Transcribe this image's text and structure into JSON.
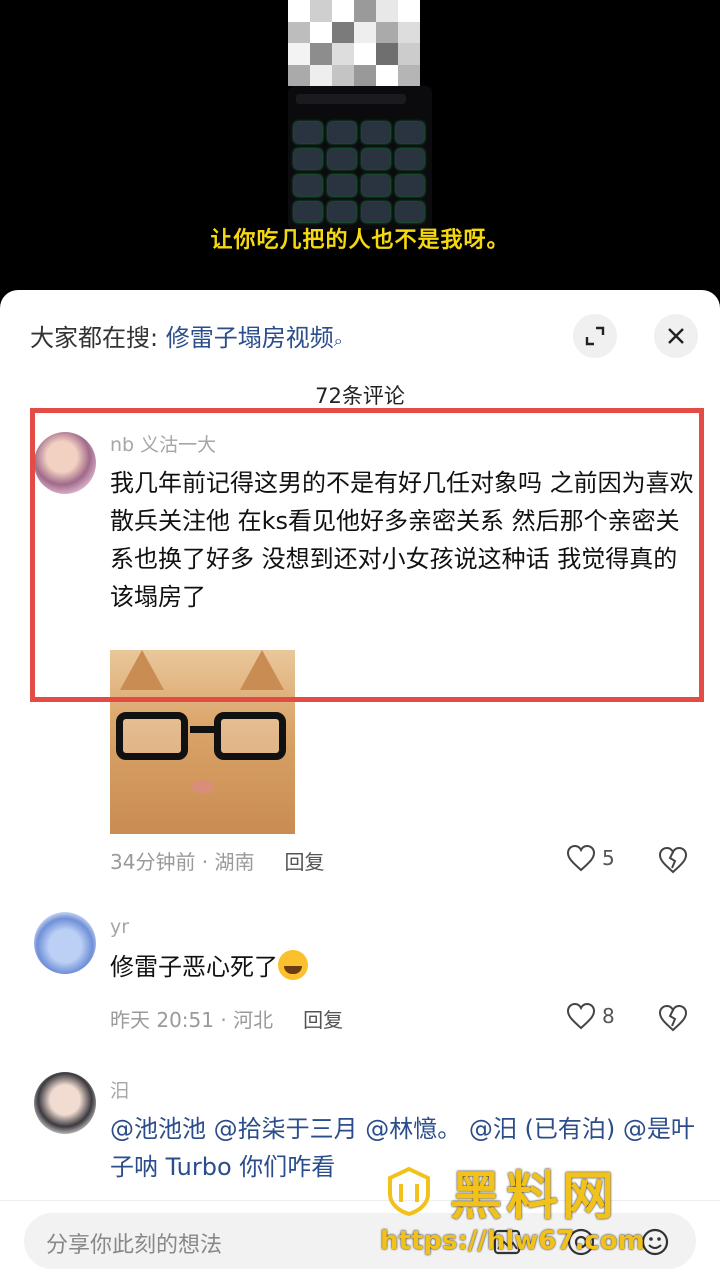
{
  "video": {
    "subtitle": "让你吃几把的人也不是我呀。"
  },
  "sheet": {
    "search_prefix": "大家都在搜:",
    "search_keyword": "修雷子塌房视频",
    "comment_count": "72条评论"
  },
  "comments": [
    {
      "username": "nb 义沽一大",
      "text": "我几年前记得这男的不是有好几任对象吗 之前因为喜欢散兵关注他 在ks看见他好多亲密关系 然后那个亲密关系也换了好多 没想到还对小女孩说这种话 我觉得真的该塌房了",
      "time_location": "34分钟前 · 湖南",
      "reply_label": "回复",
      "likes": "5"
    },
    {
      "username": "yr",
      "text": "修雷子恶心死了",
      "time_location": "昨天 20:51 · 河北",
      "reply_label": "回复",
      "likes": "8"
    },
    {
      "username": "汨",
      "text": "@池池池 @拾柒于三月 @林憶。 @汨 (已有泊) @是叶子呐 Turbo 你们咋看"
    }
  ],
  "input": {
    "placeholder": "分享你此刻的想法"
  },
  "watermark": {
    "title": "黑料网",
    "url": "https://hlw67.com"
  },
  "colors": {
    "highlight": "#e44b45",
    "link": "#2b4d8c",
    "subtitle": "#f5d80f",
    "watermark": "#f2c21a"
  }
}
